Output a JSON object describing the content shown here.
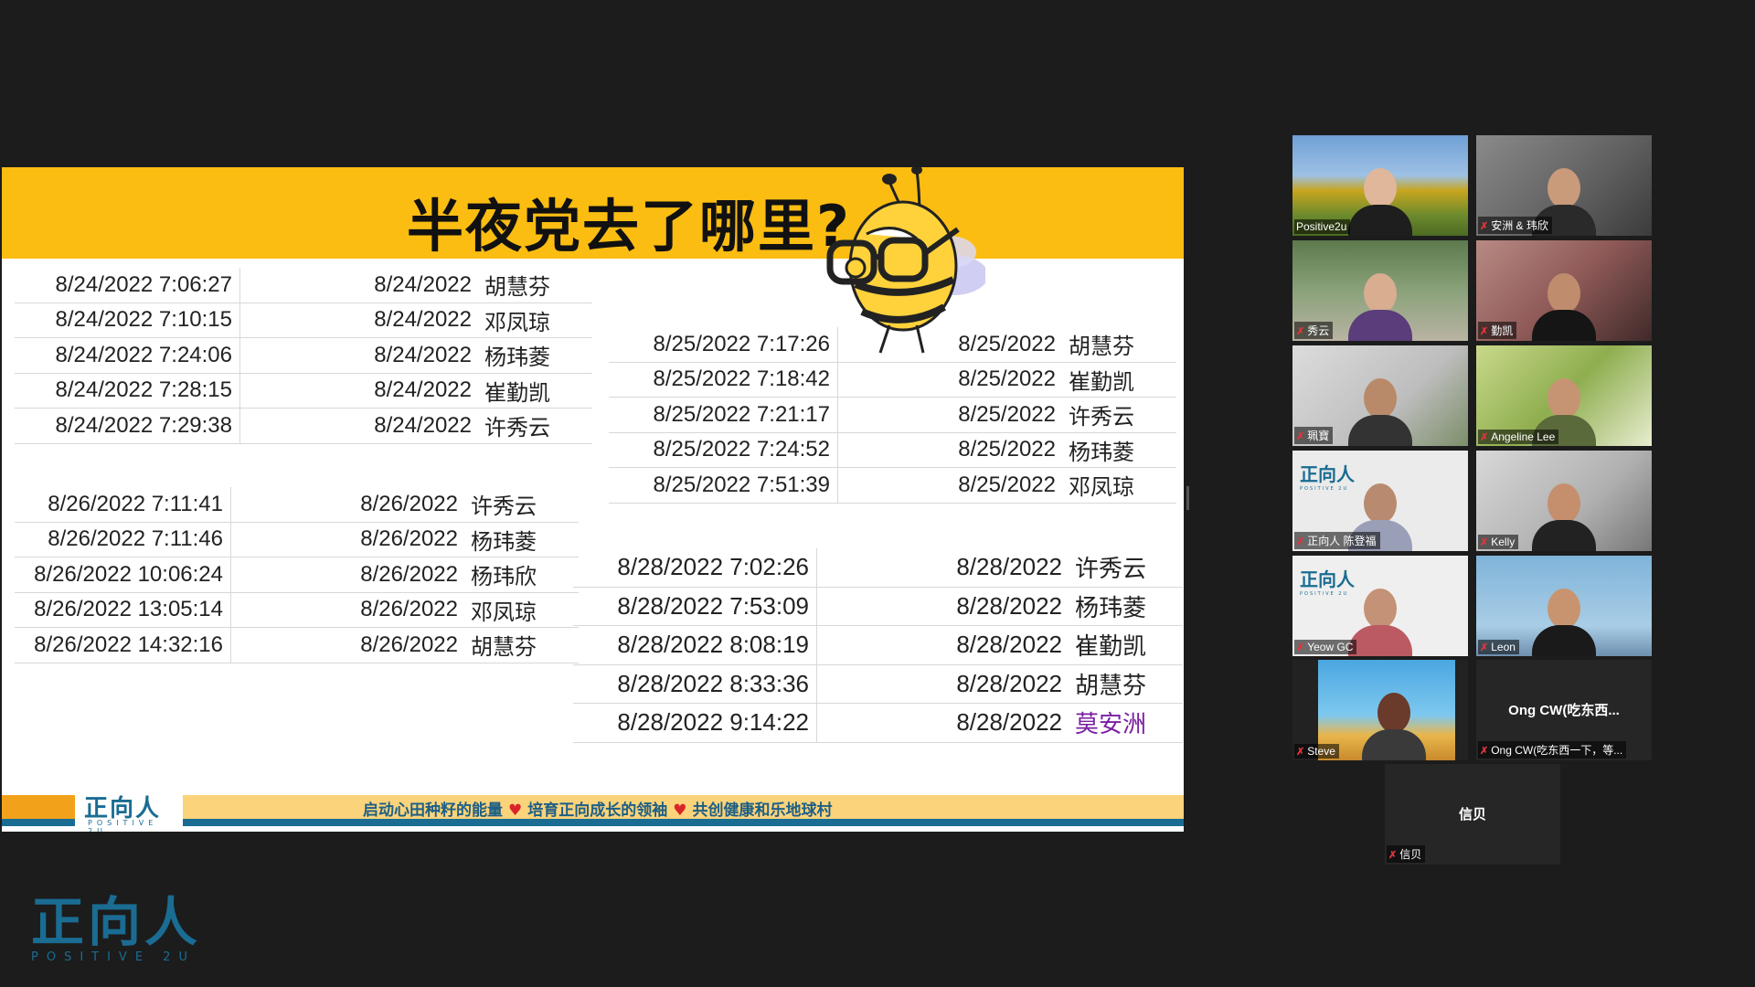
{
  "slide": {
    "title": "半夜党去了哪里?",
    "table_824": [
      [
        "8/24/2022 7:06:27",
        "8/24/2022",
        "胡慧芬"
      ],
      [
        "8/24/2022 7:10:15",
        "8/24/2022",
        "邓凤琼"
      ],
      [
        "8/24/2022 7:24:06",
        "8/24/2022",
        "杨玮菱"
      ],
      [
        "8/24/2022 7:28:15",
        "8/24/2022",
        "崔勤凯"
      ],
      [
        "8/24/2022 7:29:38",
        "8/24/2022",
        "许秀云"
      ]
    ],
    "table_825": [
      [
        "8/25/2022 7:17:26",
        "8/25/2022",
        "胡慧芬"
      ],
      [
        "8/25/2022 7:18:42",
        "8/25/2022",
        "崔勤凯"
      ],
      [
        "8/25/2022 7:21:17",
        "8/25/2022",
        "许秀云"
      ],
      [
        "8/25/2022 7:24:52",
        "8/25/2022",
        "杨玮菱"
      ],
      [
        "8/25/2022 7:51:39",
        "8/25/2022",
        "邓凤琼"
      ]
    ],
    "table_826": [
      [
        "8/26/2022 7:11:41",
        "8/26/2022",
        "许秀云"
      ],
      [
        "8/26/2022 7:11:46",
        "8/26/2022",
        "杨玮菱"
      ],
      [
        "8/26/2022 10:06:24",
        "8/26/2022",
        "杨玮欣"
      ],
      [
        "8/26/2022 13:05:14",
        "8/26/2022",
        "邓凤琼"
      ],
      [
        "8/26/2022 14:32:16",
        "8/26/2022",
        "胡慧芬"
      ]
    ],
    "table_828": [
      [
        "8/28/2022 7:02:26",
        "8/28/2022",
        "许秀云"
      ],
      [
        "8/28/2022 7:53:09",
        "8/28/2022",
        "杨玮菱"
      ],
      [
        "8/28/2022 8:08:19",
        "8/28/2022",
        "崔勤凯"
      ],
      [
        "8/28/2022 8:33:36",
        "8/28/2022",
        "胡慧芬"
      ],
      [
        "8/28/2022 9:14:22",
        "8/28/2022",
        "莫安洲"
      ]
    ],
    "footer": {
      "logo_cn": "正向人",
      "logo_en": "POSITIVE 2U",
      "slogan_1": "启动心田种籽的能量",
      "slogan_2": "培育正向成长的领袖",
      "slogan_3": "共创健康和乐地球村",
      "heart": "♥"
    }
  },
  "participants": [
    {
      "name": "Positive2u",
      "active": true,
      "muted": false
    },
    {
      "name": "安洲 & 玮欣",
      "muted": true
    },
    {
      "name": "秀云",
      "muted": true
    },
    {
      "name": "勤凯",
      "muted": true
    },
    {
      "name": "珮寶",
      "muted": true
    },
    {
      "name": "Angeline Lee",
      "muted": true
    },
    {
      "name": "正向人 陈登福",
      "muted": true,
      "logo": "正向人"
    },
    {
      "name": "Kelly",
      "muted": true
    },
    {
      "name": "Yeow GC",
      "muted": true,
      "logo": "正向人"
    },
    {
      "name": "Leon",
      "muted": true
    },
    {
      "name": "Steve",
      "muted": true
    },
    {
      "name": "Ong CW(吃东西一下，等...",
      "center": "Ong CW(吃东西...",
      "muted": true
    },
    {
      "name": "信贝",
      "center": "信贝",
      "muted": true
    }
  ],
  "mic_muted_icon": "✗",
  "background_logo": {
    "cn": "正向人",
    "en": "POSITIVE 2U"
  },
  "colors": {
    "slide_header": "#fbbd12",
    "brand_blue": "#1a6c92",
    "active_speaker": "#b4e13a"
  }
}
